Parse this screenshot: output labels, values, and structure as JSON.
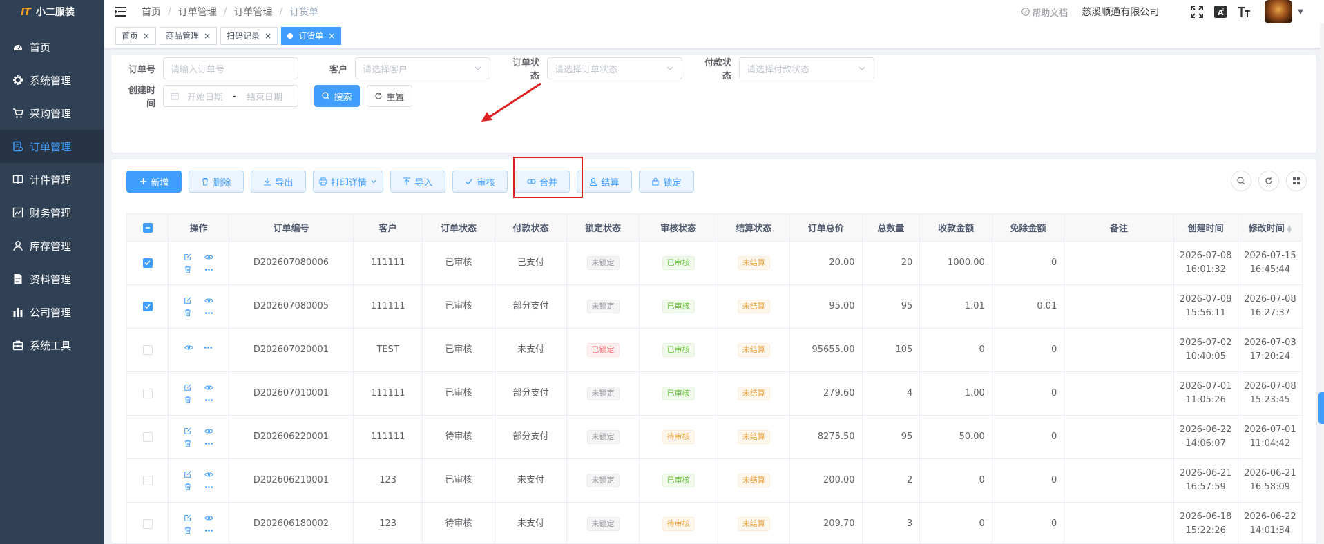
{
  "app": {
    "name": "小二服装",
    "logo_mark": "IT"
  },
  "sidebar": {
    "items": [
      {
        "label": "首页",
        "icon": "dashboard-icon"
      },
      {
        "label": "系统管理",
        "icon": "gear-icon"
      },
      {
        "label": "采购管理",
        "icon": "cart-icon"
      },
      {
        "label": "订单管理",
        "icon": "order-icon",
        "active": true
      },
      {
        "label": "计件管理",
        "icon": "book-icon"
      },
      {
        "label": "财务管理",
        "icon": "chart-icon"
      },
      {
        "label": "库存管理",
        "icon": "user-icon"
      },
      {
        "label": "资料管理",
        "icon": "document-icon"
      },
      {
        "label": "公司管理",
        "icon": "bar-chart-icon"
      },
      {
        "label": "系统工具",
        "icon": "toolbox-icon"
      }
    ]
  },
  "navbar": {
    "breadcrumb": [
      "首页",
      "订单管理",
      "订单管理",
      "订货单"
    ],
    "help": "帮助文档",
    "company": "慈溪顺通有限公司"
  },
  "tags": [
    {
      "label": "首页"
    },
    {
      "label": "商品管理"
    },
    {
      "label": "扫码记录"
    },
    {
      "label": "订货单",
      "active": true
    }
  ],
  "search": {
    "order_no": {
      "label": "订单号",
      "placeholder": "请输入订单号"
    },
    "customer": {
      "label": "客户",
      "placeholder": "请选择客户"
    },
    "order_status": {
      "label": "订单状态",
      "placeholder": "请选择订单状态"
    },
    "pay_status": {
      "label": "付款状态",
      "placeholder": "请选择付款状态"
    },
    "created": {
      "label": "创建时间",
      "start": "开始日期",
      "sep": "-",
      "end": "结束日期"
    },
    "search_btn": "搜索",
    "reset_btn": "重置"
  },
  "toolbar": {
    "add": "新增",
    "delete": "删除",
    "export": "导出",
    "print": "打印详情",
    "import": "导入",
    "audit": "审核",
    "merge": "合并",
    "settle": "结算",
    "lock": "锁定"
  },
  "colors": {
    "primary": "#409eff",
    "sidebar": "#304156",
    "highlight": "#e02020"
  },
  "table": {
    "headers": [
      "",
      "操作",
      "订单编号",
      "客户",
      "订单状态",
      "付款状态",
      "锁定状态",
      "审核状态",
      "结算状态",
      "订单总价",
      "总数量",
      "收款金额",
      "免除金额",
      "备注",
      "创建时间",
      "修改时间"
    ],
    "rows": [
      {
        "checked": true,
        "ops": "full",
        "no": "D202607080006",
        "customer": "111111",
        "status": "已审核",
        "pay": "已支付",
        "lock": "未锁定",
        "lock_type": "info",
        "audit": "已审核",
        "audit_type": "success",
        "settle": "未结算",
        "total": "20.00",
        "qty": "20",
        "received": "1000.00",
        "waived": "0",
        "remark": "",
        "created_d": "2026-07-08",
        "created_t": "16:01:32",
        "modified_d": "2026-07-15",
        "modified_t": "16:45:44"
      },
      {
        "checked": true,
        "ops": "full",
        "no": "D202607080005",
        "customer": "111111",
        "status": "已审核",
        "pay": "部分支付",
        "lock": "未锁定",
        "lock_type": "info",
        "audit": "已审核",
        "audit_type": "success",
        "settle": "未结算",
        "total": "95.00",
        "qty": "95",
        "received": "1.01",
        "waived": "0.01",
        "remark": "",
        "created_d": "2026-07-08",
        "created_t": "15:56:11",
        "modified_d": "2026-07-08",
        "modified_t": "16:27:37"
      },
      {
        "checked": false,
        "ops": "view",
        "no": "D202607020001",
        "customer": "TEST",
        "status": "已审核",
        "pay": "未支付",
        "lock": "已锁定",
        "lock_type": "danger",
        "audit": "已审核",
        "audit_type": "success",
        "settle": "未结算",
        "total": "95655.00",
        "qty": "105",
        "received": "0",
        "waived": "0",
        "remark": "",
        "created_d": "2026-07-02",
        "created_t": "10:40:05",
        "modified_d": "2026-07-03",
        "modified_t": "17:20:24"
      },
      {
        "checked": false,
        "ops": "full",
        "no": "D202607010001",
        "customer": "111111",
        "status": "已审核",
        "pay": "部分支付",
        "lock": "未锁定",
        "lock_type": "info",
        "audit": "已审核",
        "audit_type": "success",
        "settle": "未结算",
        "total": "279.60",
        "qty": "4",
        "received": "1.00",
        "waived": "0",
        "remark": "",
        "created_d": "2026-07-01",
        "created_t": "11:05:26",
        "modified_d": "2026-07-08",
        "modified_t": "15:23:45"
      },
      {
        "checked": false,
        "ops": "full",
        "no": "D202606220001",
        "customer": "111111",
        "status": "待审核",
        "pay": "部分支付",
        "lock": "未锁定",
        "lock_type": "info",
        "audit": "待审核",
        "audit_type": "warning",
        "settle": "未结算",
        "total": "8275.50",
        "qty": "95",
        "received": "50.00",
        "waived": "0",
        "remark": "",
        "created_d": "2026-06-22",
        "created_t": "14:06:07",
        "modified_d": "2026-07-01",
        "modified_t": "11:04:42"
      },
      {
        "checked": false,
        "ops": "full",
        "no": "D202606210001",
        "customer": "123",
        "status": "已审核",
        "pay": "未支付",
        "lock": "未锁定",
        "lock_type": "info",
        "audit": "已审核",
        "audit_type": "success",
        "settle": "未结算",
        "total": "200.00",
        "qty": "2",
        "received": "0",
        "waived": "0",
        "remark": "",
        "created_d": "2026-06-21",
        "created_t": "16:57:59",
        "modified_d": "2026-06-21",
        "modified_t": "16:58:09"
      },
      {
        "checked": false,
        "ops": "full",
        "no": "D202606180002",
        "customer": "123",
        "status": "待审核",
        "pay": "未支付",
        "lock": "未锁定",
        "lock_type": "info",
        "audit": "待审核",
        "audit_type": "warning",
        "settle": "未结算",
        "total": "209.70",
        "qty": "3",
        "received": "0",
        "waived": "0",
        "remark": "",
        "created_d": "2026-06-18",
        "created_t": "15:22:26",
        "modified_d": "2026-06-22",
        "modified_t": "14:01:34"
      }
    ]
  }
}
